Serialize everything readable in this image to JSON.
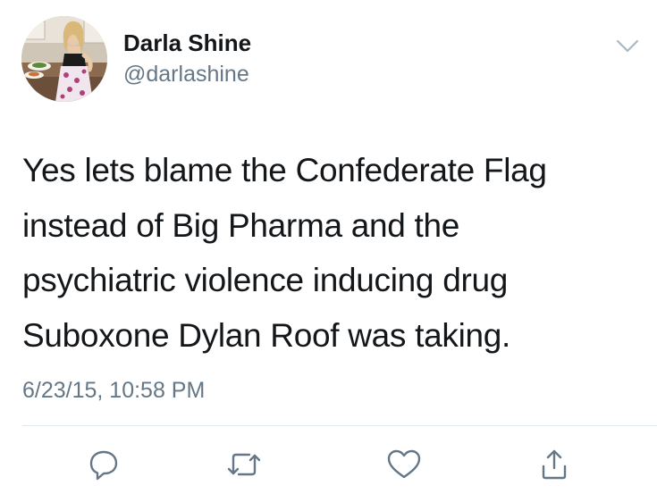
{
  "user": {
    "display_name": "Darla Shine",
    "handle": "@darlashine"
  },
  "tweet": {
    "lines": [
      "Yes lets blame the Confederate Flag",
      "instead of Big Pharma and the",
      "psychiatric violence inducing drug",
      "Suboxone Dylan Roof was taking."
    ],
    "timestamp": "6/23/15, 10:58 PM"
  },
  "icons": {
    "menu": "chevron-down-icon",
    "reply": "reply-icon",
    "retweet": "retweet-icon",
    "like": "heart-icon",
    "share": "share-icon"
  },
  "colors": {
    "text": "#14171a",
    "secondary": "#657786",
    "icon": "#657786",
    "divider": "#e1e8ed"
  }
}
